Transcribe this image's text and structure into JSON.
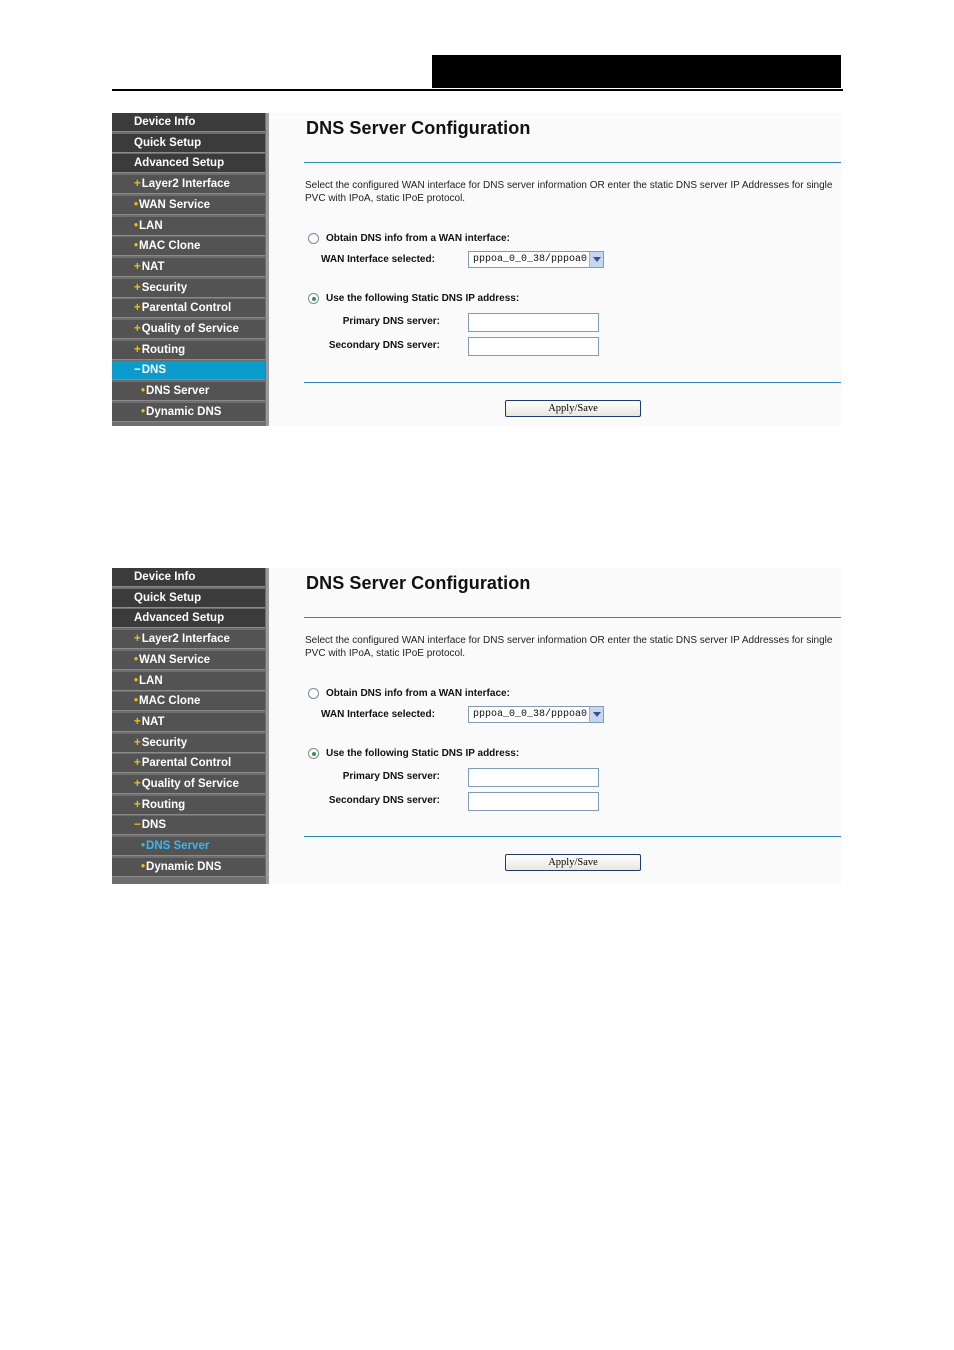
{
  "screens": [
    {
      "nav": [
        {
          "label": "Device Info",
          "bullet": "",
          "level": 0,
          "state": "dark"
        },
        {
          "label": "Quick Setup",
          "bullet": "",
          "level": 0,
          "state": "dark"
        },
        {
          "label": "Advanced Setup",
          "bullet": "",
          "level": 0,
          "state": "dark"
        },
        {
          "label": "Layer2 Interface",
          "bullet": "+",
          "level": 1,
          "state": "normal"
        },
        {
          "label": "WAN Service",
          "bullet": "•",
          "level": 1,
          "state": "normal"
        },
        {
          "label": "LAN",
          "bullet": "•",
          "level": 1,
          "state": "normal"
        },
        {
          "label": "MAC Clone",
          "bullet": "•",
          "level": 1,
          "state": "normal"
        },
        {
          "label": "NAT",
          "bullet": "+",
          "level": 1,
          "state": "normal"
        },
        {
          "label": "Security",
          "bullet": "+",
          "level": 1,
          "state": "normal"
        },
        {
          "label": "Parental Control",
          "bullet": "+",
          "level": 1,
          "state": "normal"
        },
        {
          "label": "Quality of Service",
          "bullet": "+",
          "level": 1,
          "state": "normal"
        },
        {
          "label": "Routing",
          "bullet": "+",
          "level": 1,
          "state": "normal"
        },
        {
          "label": "DNS",
          "bullet": "−",
          "level": 1,
          "state": "active"
        },
        {
          "label": "DNS Server",
          "bullet": "•",
          "level": 2,
          "state": "normal"
        },
        {
          "label": "Dynamic DNS",
          "bullet": "•",
          "level": 2,
          "state": "normal"
        }
      ],
      "form": {
        "title": "DNS Server Configuration",
        "description": "Select the configured WAN interface for DNS server information OR enter the static DNS server IP Addresses for single PVC with IPoA, static IPoE protocol.",
        "radio_wan_label": "Obtain DNS info from a WAN interface:",
        "radio_wan_checked": false,
        "wan_interface_label": "WAN Interface selected:",
        "wan_interface_value": "pppoa_0_0_38/pppoa0",
        "radio_static_label": "Use the following Static DNS IP address:",
        "radio_static_checked": true,
        "primary_label": "Primary DNS server:",
        "primary_value": "",
        "secondary_label": "Secondary DNS server:",
        "secondary_value": "",
        "apply_label": "Apply/Save"
      }
    },
    {
      "nav": [
        {
          "label": "Device Info",
          "bullet": "",
          "level": 0,
          "state": "dark"
        },
        {
          "label": "Quick Setup",
          "bullet": "",
          "level": 0,
          "state": "dark"
        },
        {
          "label": "Advanced Setup",
          "bullet": "",
          "level": 0,
          "state": "dark"
        },
        {
          "label": "Layer2 Interface",
          "bullet": "+",
          "level": 1,
          "state": "normal"
        },
        {
          "label": "WAN Service",
          "bullet": "•",
          "level": 1,
          "state": "normal"
        },
        {
          "label": "LAN",
          "bullet": "•",
          "level": 1,
          "state": "normal"
        },
        {
          "label": "MAC Clone",
          "bullet": "•",
          "level": 1,
          "state": "normal"
        },
        {
          "label": "NAT",
          "bullet": "+",
          "level": 1,
          "state": "normal"
        },
        {
          "label": "Security",
          "bullet": "+",
          "level": 1,
          "state": "normal"
        },
        {
          "label": "Parental Control",
          "bullet": "+",
          "level": 1,
          "state": "normal"
        },
        {
          "label": "Quality of Service",
          "bullet": "+",
          "level": 1,
          "state": "normal"
        },
        {
          "label": "Routing",
          "bullet": "+",
          "level": 1,
          "state": "normal"
        },
        {
          "label": "DNS",
          "bullet": "−",
          "level": 1,
          "state": "normal"
        },
        {
          "label": "DNS Server",
          "bullet": "•",
          "level": 2,
          "state": "selected"
        },
        {
          "label": "Dynamic DNS",
          "bullet": "•",
          "level": 2,
          "state": "normal"
        }
      ],
      "form": {
        "title": "DNS Server Configuration",
        "description": "Select the configured WAN interface for DNS server information OR enter the static DNS server IP Addresses for single PVC with IPoA, static IPoE protocol.",
        "radio_wan_label": "Obtain DNS info from a WAN interface:",
        "radio_wan_checked": false,
        "wan_interface_label": "WAN Interface selected:",
        "wan_interface_value": "pppoa_0_0_38/pppoa0",
        "radio_static_label": "Use the following Static DNS IP address:",
        "radio_static_checked": true,
        "primary_label": "Primary DNS server:",
        "primary_value": "",
        "secondary_label": "Secondary DNS server:",
        "secondary_value": "",
        "apply_label": "Apply/Save"
      }
    }
  ]
}
